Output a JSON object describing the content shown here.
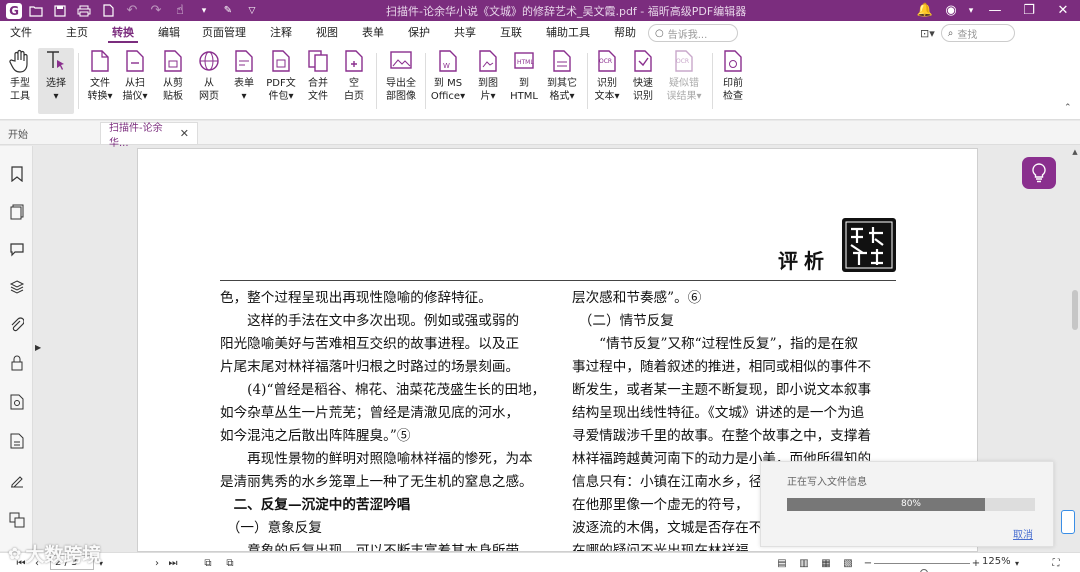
{
  "window": {
    "title": "扫描件-论余华小说《文城》的修辞艺术_吴文霞.pdf - 福昕高级PDF编辑器"
  },
  "menu": {
    "tabs": [
      "文件",
      "主页",
      "转换",
      "编辑",
      "页面管理",
      "注释",
      "视图",
      "表单",
      "保护",
      "共享",
      "互联",
      "辅助工具",
      "帮助"
    ],
    "active_tab": "转换",
    "tell_me_placeholder": "告诉我...",
    "search_placeholder": "查找"
  },
  "ribbon": {
    "hand_line1": "手型",
    "hand_line2": "工具",
    "select_line1": "选择",
    "file_convert_line1": "文件",
    "file_convert_line2": "转换▾",
    "from_scanner_line1": "从扫",
    "from_scanner_line2": "描仪▾",
    "from_clipboard_line1": "从剪",
    "from_clipboard_line2": "贴板",
    "from_web_line1": "从",
    "from_web_line2": "网页",
    "form_line1": "表单",
    "form_line2": "",
    "pdf_package_line1": "PDF文",
    "pdf_package_line2": "件包▾",
    "combine_line1": "合并",
    "combine_line2": "文件",
    "blank_line1": "空",
    "blank_line2": "白页",
    "export_images_line1": "导出全",
    "export_images_line2": "部图像",
    "to_office_line1": "到 MS",
    "to_office_line2": "Office▾",
    "to_image_line1": "到图",
    "to_image_line2": "片▾",
    "to_html_line1": "到",
    "to_html_line2": "HTML",
    "to_other_line1": "到其它",
    "to_other_line2": "格式▾",
    "ocr_line1": "识别",
    "ocr_line2": "文本▾",
    "quick_ocr_line1": "快速",
    "quick_ocr_line2": "识别",
    "suspect_line1": "疑似错",
    "suspect_line2": "误结果▾",
    "preflight_line1": "印前",
    "preflight_line2": "检查"
  },
  "doc_tabs": {
    "home": "开始",
    "active": "扫描件-论余华..."
  },
  "page": {
    "section_label": "评析",
    "left_lines": [
      "色，整个过程呈现出再现性隐喻的修辞特征。",
      "　　这样的手法在文中多次出现。例如或强或弱的",
      "阳光隐喻美好与苦难相互交织的故事进程。以及正",
      "片尾末尾对林祥福落叶归根之时路过的场景刻画。",
      "　　(4)“曾经是稻谷、棉花、油菜花茂盛生长的田地，",
      "如今杂草丛生一片荒芜；曾经是清澈见底的河水，",
      "如今混沌之后散出阵阵腥臭。”⑤",
      "　　再现性景物的鲜明对照隐喻林祥福的惨死，为本",
      "是清丽隽秀的水乡笼罩上一种了无生机的窒息之感。",
      "　二、反复—沉淀中的苦涩吟唱",
      "　（一）意象反复",
      "　　意象的反复出现，可以不断丰富着其本身所带"
    ],
    "right_lines": [
      "层次感和节奏感”。⑥",
      "　（二）情节反复",
      "　　“情节反复”又称“过程性反复”，指的是在叙",
      "事过程中，随着叙述的推进，相同或相似的事件不",
      "断发生，或者某一主题不断复现，即小说文本叙事",
      "结构呈现出线性特征。《文城》讲述的是一个为追",
      "寻爱情跋涉千里的故事。在整个故事之中，支撑着",
      "林祥福跨越黄河南下的动力是小美，而他所得知的",
      "信息只有：小镇在江南水乡，径",
      "在他那里像一个虚无的符号，",
      "波逐流的木偶，文城是否存在不",
      "在哪的疑问不光出现在林祥福"
    ]
  },
  "progress_dialog": {
    "title": "正在写入文件信息",
    "percent_label": "80%",
    "percent": 80,
    "cancel_label": "取消"
  },
  "status": {
    "page_indicator": "2 / 3",
    "zoom_label": "125%",
    "zoom_fraction": 0.52
  },
  "watermark": {
    "text": "大数跨境"
  },
  "colors": {
    "brand_purple": "#7b2d7e",
    "accent_purple": "#8a2f8e",
    "progress_fill": "#777777",
    "link_blue": "#4a6fd0"
  }
}
